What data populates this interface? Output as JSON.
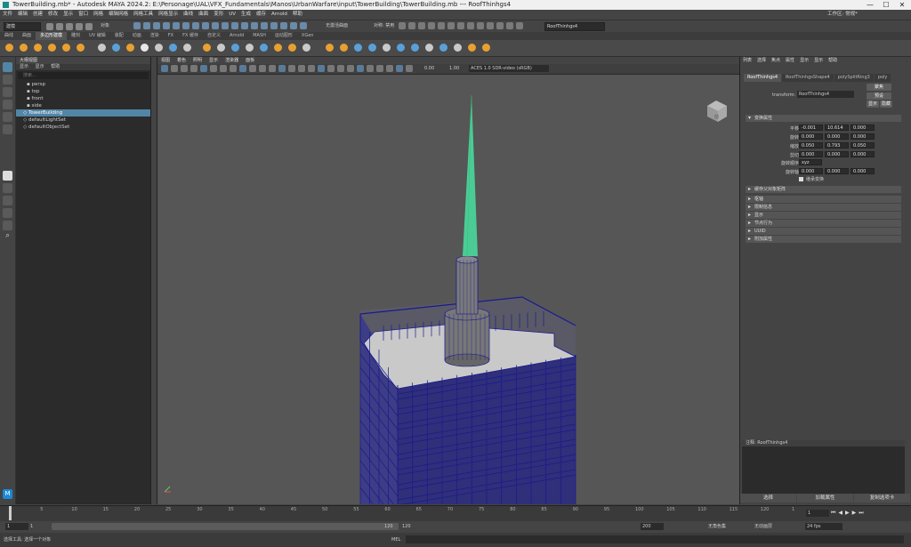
{
  "titlebar": {
    "title": "TowerBuilding.mb* - Autodesk MAYA 2024.2: E:\\Personage\\UAL\\VFX_Fundamentals\\Manos\\UrbanWarfare\\input\\TowerBuilding\\TowerBuilding.mb  ---  RoofThinhgs4",
    "minimize": "—",
    "maximize": "☐",
    "close": "✕",
    "workspace_label": "工作区: 常规*"
  },
  "menubar": [
    "文件",
    "编辑",
    "创建",
    "修改",
    "显示",
    "窗口",
    "网格",
    "编辑网格",
    "网格工具",
    "网格显示",
    "曲线",
    "曲面",
    "变形",
    "UV",
    "生成",
    "缓存",
    "Arnold",
    "帮助"
  ],
  "statusline": {
    "mode": "建模",
    "object_label": "对象",
    "live_surface": "无激活曲面",
    "symmetry": "对称: 禁用",
    "search": "RoofThinhgs4"
  },
  "shelf_tabs": [
    "曲线",
    "曲面",
    "多边形建模",
    "雕刻",
    "UV 编辑",
    "装配",
    "动画",
    "渲染",
    "FX",
    "FX 缓存",
    "自定义",
    "Arnold",
    "MASH",
    "运动图形",
    "XGen"
  ],
  "shelf_active": 2,
  "outliner": {
    "title": "大纲视图",
    "menu": [
      "显示",
      "显示",
      "帮助"
    ],
    "search_placeholder": "搜索...",
    "items": [
      {
        "label": "persp",
        "camera": true
      },
      {
        "label": "top",
        "camera": true
      },
      {
        "label": "front",
        "camera": true
      },
      {
        "label": "side",
        "camera": true
      },
      {
        "label": "TowerBuilding",
        "selected": true
      },
      {
        "label": "defaultLightSet"
      },
      {
        "label": "defaultObjectSet"
      }
    ]
  },
  "viewport": {
    "menu": [
      "视图",
      "着色",
      "照明",
      "显示",
      "渲染器",
      "面板"
    ],
    "near": "0.00",
    "far": "1.00",
    "colorspace": "ACES 1.0 SDR-video (sRGB)",
    "viewcube": "前",
    "colors": {
      "wire": "#1a1a8f",
      "spire": "#49e0a0",
      "roof": "#c8c8c8",
      "bg": "#575757"
    }
  },
  "attr_editor": {
    "menu": [
      "列表",
      "选择",
      "焦点",
      "属性",
      "显示",
      "显示",
      "帮助"
    ],
    "tabs": [
      "RoofThinhgs4",
      "RoofThinhgsShape4",
      "polySplitRing3",
      "poly"
    ],
    "transform_label": "transform:",
    "transform_value": "RoofThinhgs4",
    "focus_btn": "聚焦",
    "presets_btn": "预设",
    "show_btn": "显示",
    "hide_btn": "隐藏",
    "sections_open": "变换属性",
    "rows": [
      {
        "label": "平移",
        "v": [
          "-0.001",
          "10.614",
          "0.000"
        ]
      },
      {
        "label": "旋转",
        "v": [
          "0.000",
          "0.000",
          "0.000"
        ]
      },
      {
        "label": "缩放",
        "v": [
          "0.050",
          "0.793",
          "0.050"
        ]
      },
      {
        "label": "剪切",
        "v": [
          "0.000",
          "0.000",
          "0.000"
        ]
      }
    ],
    "rotate_order_label": "旋转顺序",
    "rotate_order": "xyz",
    "rotate_axis_label": "旋转轴",
    "rotate_axis": [
      "0.000",
      "0.000",
      "0.000"
    ],
    "inherit_label": "继承变换",
    "sections": [
      "枢轴",
      "限制信息",
      "显示",
      "节点行为",
      "UUID",
      "附加属性"
    ],
    "pivot_section": "枢轴",
    "parent_label": "缓存父对象矩阵",
    "notes_label": "注释: RoofThinhgs4",
    "bottom": [
      "选择",
      "加载属性",
      "复制选项卡"
    ]
  },
  "timeline": {
    "ticks": [
      "1",
      "5",
      "10",
      "15",
      "20",
      "25",
      "30",
      "35",
      "40",
      "45",
      "50",
      "55",
      "60",
      "65",
      "70",
      "75",
      "80",
      "85",
      "90",
      "95",
      "100",
      "105",
      "110",
      "115",
      "120",
      "1"
    ],
    "current_frame": "1"
  },
  "range": {
    "start": "1",
    "start2": "1",
    "end1": "120",
    "end2": "120",
    "end3": "200",
    "char_set": "无角色集",
    "anim_layer": "无动画层",
    "fps": "24 fps"
  },
  "cmdline": {
    "mel": "MEL",
    "help": "选择工具: 选择一个对象"
  }
}
